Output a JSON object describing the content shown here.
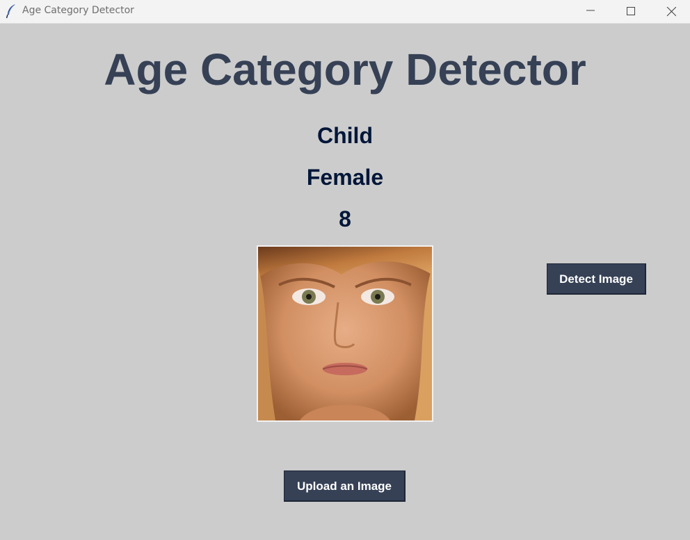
{
  "window": {
    "title": "Age Category Detector",
    "app_icon": "feather-icon",
    "controls": [
      "minimize-icon",
      "maximize-icon",
      "close-icon"
    ]
  },
  "heading": "Age Category Detector",
  "results": {
    "age_category": "Child",
    "gender": "Female",
    "age": "8"
  },
  "image": {
    "description_icon": "uploaded-face-image"
  },
  "buttons": {
    "detect": "Detect Image",
    "upload": "Upload an Image"
  },
  "colors": {
    "background": "#cccccc",
    "heading": "#364156",
    "result_text": "#011638",
    "button_bg": "#364156",
    "button_text": "#ffffff"
  }
}
